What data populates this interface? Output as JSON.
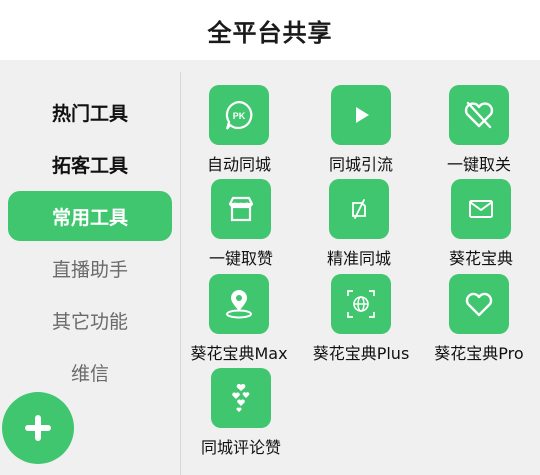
{
  "header": {
    "title": "全平台共享"
  },
  "sidebar": {
    "items": [
      {
        "label": "热门工具"
      },
      {
        "label": "拓客工具"
      },
      {
        "label": "常用工具"
      },
      {
        "label": "直播助手"
      },
      {
        "label": "其它功能"
      },
      {
        "label": "维信"
      }
    ],
    "active_index": 2
  },
  "fab": {
    "icon": "plus-icon"
  },
  "tools": [
    {
      "label": "自动同城",
      "icon": "pk-chat-icon"
    },
    {
      "label": "同城引流",
      "icon": "play-icon"
    },
    {
      "label": "一键取关",
      "icon": "broken-heart-icon"
    },
    {
      "label": "一键取赞",
      "icon": "store-icon"
    },
    {
      "label": "精准同城",
      "icon": "edit-slash-icon"
    },
    {
      "label": "葵花宝典",
      "icon": "mail-icon"
    },
    {
      "label": "葵花宝典Max",
      "icon": "location-pin-icon"
    },
    {
      "label": "葵花宝典Plus",
      "icon": "globe-expand-icon"
    },
    {
      "label": "葵花宝典Pro",
      "icon": "heart-icon"
    },
    {
      "label": "同城评论赞",
      "icon": "hearts-cluster-icon"
    }
  ],
  "colors": {
    "accent": "#3fc66e",
    "background": "#f0f0f0"
  }
}
